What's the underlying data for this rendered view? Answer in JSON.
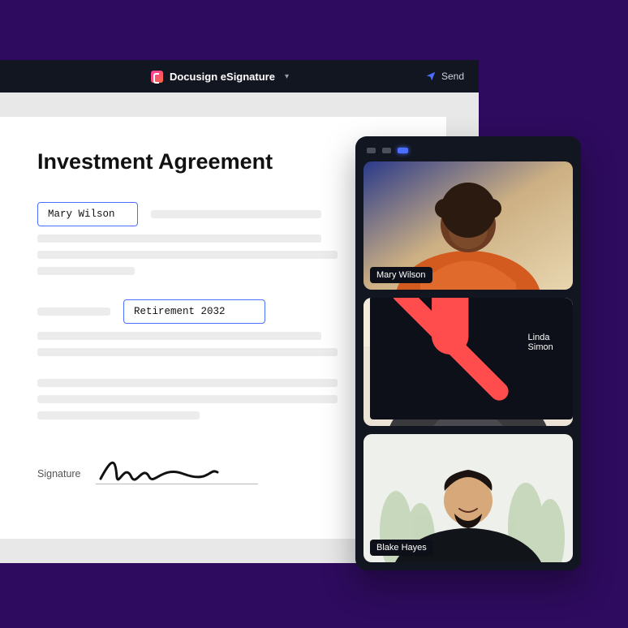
{
  "app": {
    "title": "Docusign eSignature",
    "send_label": "Send"
  },
  "document": {
    "heading": "Investment Agreement",
    "field_name": "Mary Wilson",
    "field_plan": "Retirement 2032",
    "signature_label": "Signature"
  },
  "call": {
    "participants": [
      {
        "name": "Mary Wilson",
        "muted": false
      },
      {
        "name": "Linda Simon",
        "muted": true
      },
      {
        "name": "Blake Hayes",
        "muted": false
      }
    ]
  }
}
